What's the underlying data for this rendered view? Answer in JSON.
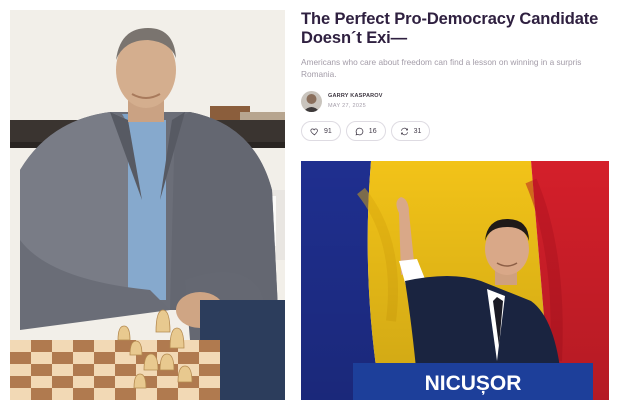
{
  "article": {
    "title": "The Perfect Pro-Democracy Candidate\nDoesn´t Exi—",
    "subtitle": "Americans who care about freedom can find a lesson on winning in a surpris",
    "subtitle_line2": "Romania.",
    "author": "GARRY KASPAROV",
    "date": "MAY 27, 2025",
    "actions": [
      {
        "icon": "heart-icon",
        "count": "91"
      },
      {
        "icon": "comment-icon",
        "count": "16"
      },
      {
        "icon": "restack-icon",
        "count": "31"
      }
    ]
  },
  "hero": {
    "banner": "NICUȘOR"
  },
  "colors": {
    "title": "#2f2040",
    "flag_blue": "#1f2f8f",
    "flag_yellow": "#f2c318",
    "flag_red": "#d41f2a",
    "banner": "#1d3f9a"
  }
}
